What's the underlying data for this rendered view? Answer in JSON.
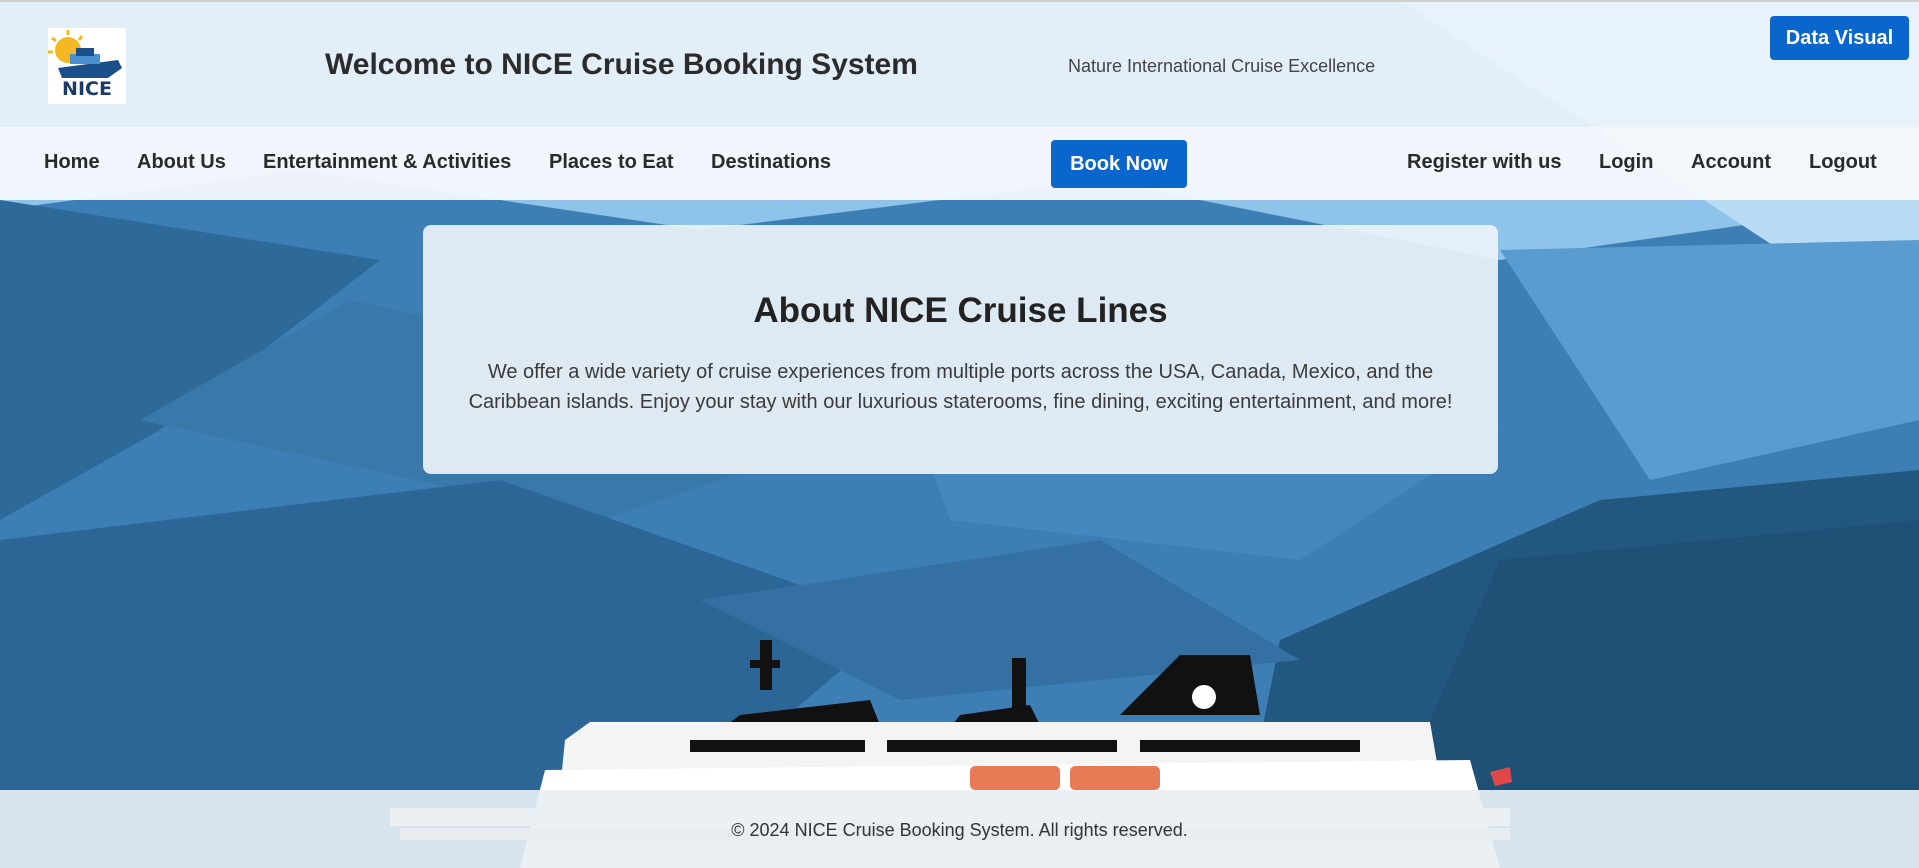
{
  "header": {
    "logo_text": "NICE",
    "title": "Welcome to NICE Cruise Booking System",
    "tagline": "Nature International Cruise Excellence",
    "data_visual_label": "Data Visual"
  },
  "nav": {
    "left_items": [
      {
        "label": "Home"
      },
      {
        "label": "About Us"
      },
      {
        "label": "Entertainment & Activities"
      },
      {
        "label": "Places to Eat"
      },
      {
        "label": "Destinations"
      }
    ],
    "book_now_label": "Book Now",
    "right_items": [
      {
        "label": "Register with us"
      },
      {
        "label": "Login"
      },
      {
        "label": "Account"
      },
      {
        "label": "Logout"
      }
    ]
  },
  "about": {
    "title": "About NICE Cruise Lines",
    "line1": "We offer a wide variety of cruise experiences from multiple ports across the USA, Canada, Mexico, and the",
    "line2": "Caribbean islands. Enjoy your stay with our luxurious staterooms, fine dining, exciting entertainment, and more!"
  },
  "footer": {
    "copyright": "© 2024 NICE Cruise Booking System. All rights reserved."
  },
  "colors": {
    "accent": "#0a66cc",
    "sky_dark": "#2f6f9f",
    "sky_light": "#7db9e6"
  }
}
